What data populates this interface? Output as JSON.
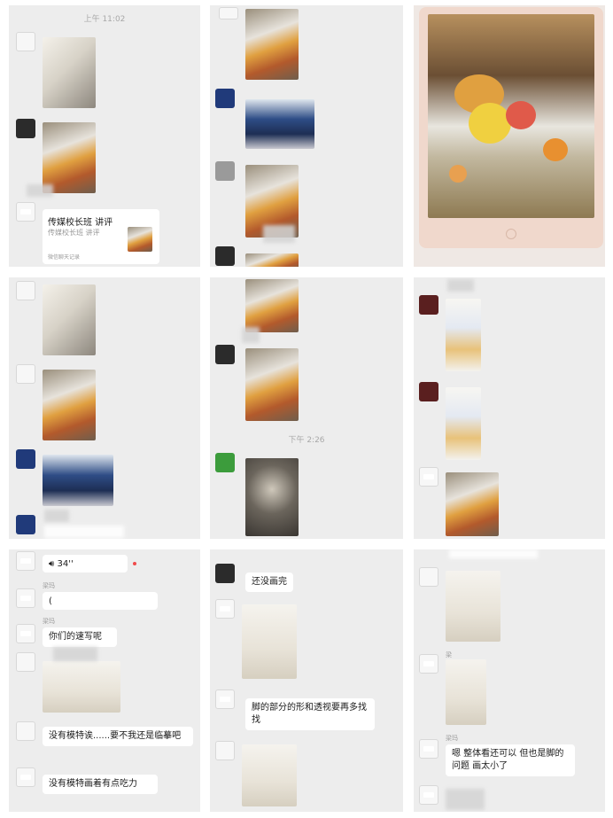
{
  "colors": {
    "panel_bg": "#ededed",
    "bubble_bg": "#ffffff",
    "timestamp": "#a8a8a8"
  },
  "panel1": {
    "timestamp": "上午 11:02",
    "card": {
      "title": "传媒校长班 讲评",
      "subtitle": "传媒校长班 讲评",
      "footer": "微信聊天记录"
    }
  },
  "panel6": {
    "timestamp": "下午 2:26"
  },
  "panel7": {
    "voice": {
      "label": "34''"
    },
    "name1": "梁玛",
    "name2": "梁玛",
    "msg1": "你们的速写呢",
    "msg2": "没有模特诶......要不我还是临摹吧",
    "msg3": "没有模特画着有点吃力"
  },
  "panel8": {
    "msg1": "还没画完",
    "msg2": "脚的部分的形和透视要再多找找"
  },
  "panel9": {
    "name1": "梁",
    "name2": "梁玛",
    "msg1": "嗯 整体看还可以 但也是脚的问题 画太小了"
  }
}
